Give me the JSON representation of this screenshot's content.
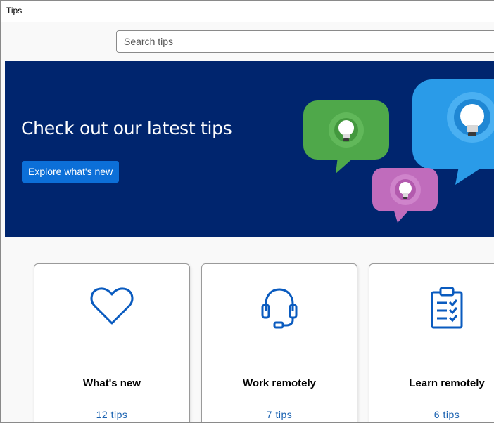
{
  "window": {
    "title": "Tips"
  },
  "search": {
    "placeholder": "Search tips",
    "value": ""
  },
  "banner": {
    "headline": "Check out our latest tips",
    "button_label": "Explore what's new",
    "background": "#00256e",
    "button_color": "#0c6fd8"
  },
  "cards": [
    {
      "title": "What's new",
      "count": "12 tips",
      "icon": "heart-icon"
    },
    {
      "title": "Work remotely",
      "count": "7 tips",
      "icon": "headset-icon"
    },
    {
      "title": "Learn remotely",
      "count": "6 tips",
      "icon": "clipboard-checklist-icon"
    }
  ],
  "colors": {
    "accent": "#0c6fd8",
    "icon_blue": "#0a5bbf",
    "link_blue": "#1a62b1"
  }
}
